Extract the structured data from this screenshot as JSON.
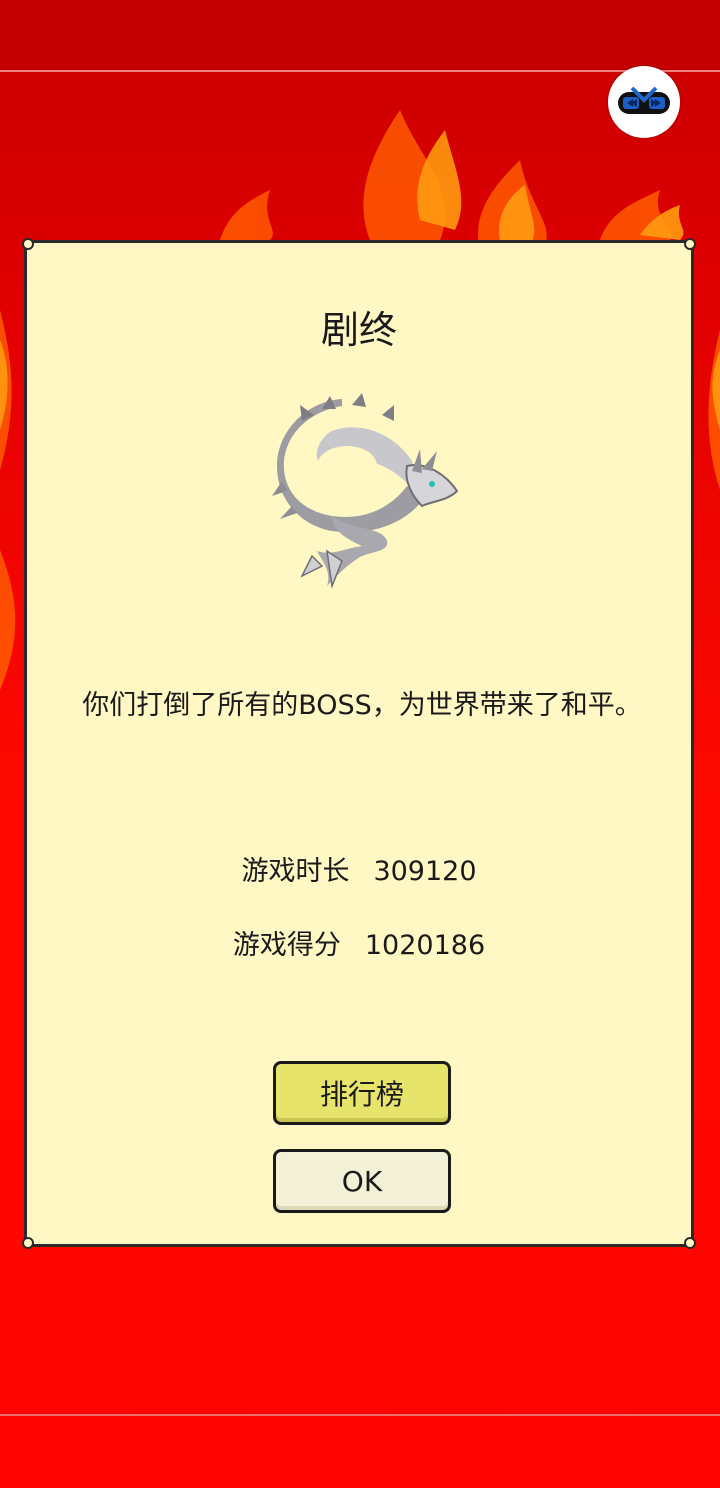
{
  "dialog": {
    "title": "剧终",
    "message": "你们打倒了所有的BOSS，为世界带来了和平。",
    "stats": [
      {
        "label": "游戏时长",
        "value": "309120"
      },
      {
        "label": "游戏得分",
        "value": "1020186"
      }
    ],
    "buttons": {
      "leaderboard": "排行榜",
      "ok": "OK"
    }
  },
  "icons": {
    "boss": "white-dragon-icon",
    "overlay": "game-controller-icon"
  },
  "colors": {
    "background": "#ff0a00",
    "panel": "#fff8c4",
    "leaderboard_button": "#e6e46a",
    "ok_button": "#f2f0d6"
  }
}
